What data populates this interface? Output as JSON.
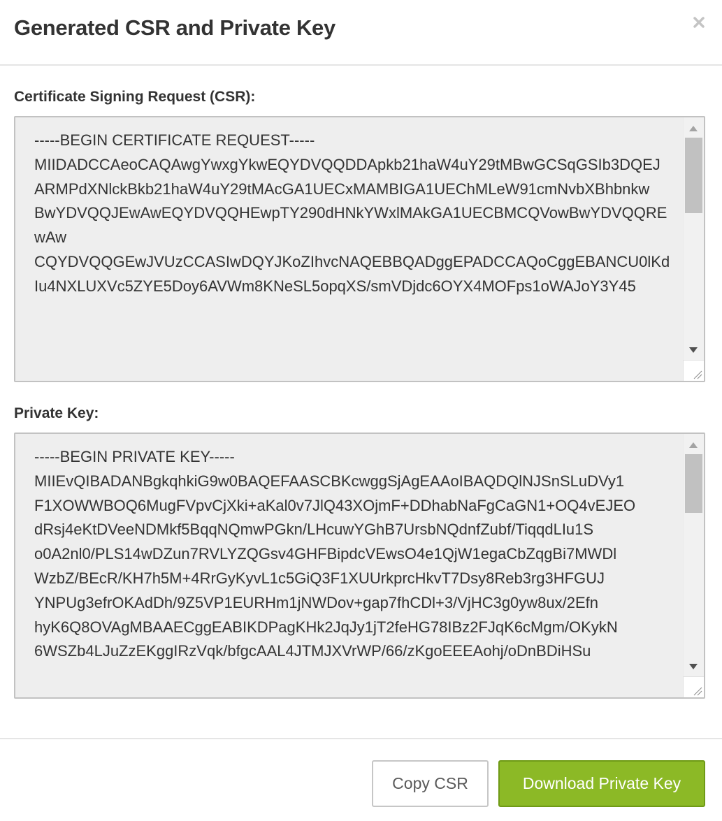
{
  "modal": {
    "title": "Generated CSR and Private Key",
    "close_icon": "close-icon"
  },
  "csr": {
    "label": "Certificate Signing Request (CSR):",
    "value": "-----BEGIN CERTIFICATE REQUEST-----\nMIIDADCCAeoCAQAwgYwxgYkwEQYDVQQDDApkb21haW4uY29tMBwGCSqGSIb3DQEJ\nARMPdXNlckBkb21haW4uY29tMAcGA1UECxMAMBIGA1UEChMLeW91cmNvbXBhbnkw\nBwYDVQQJEwAwEQYDVQQHEwpTY290dHNkYWxlMAkGA1UECBMCQVowBwYDVQQREwAw\nCQYDVQQGEwJVUzCCASIwDQYJKoZIhvcNAQEBBQADggEPADCCAQoCggEBANCU0lKd\nIu4NXLUXVc5ZYE5Doy6AVWm8KNeSL5opqXS/smVDjdc6OYX4MOFps1oWAJoY3Y45"
  },
  "private_key": {
    "label": "Private Key:",
    "value": "-----BEGIN PRIVATE KEY-----\nMIIEvQIBADANBgkqhkiG9w0BAQEFAASCBKcwggSjAgEAAoIBAQDQlNJSnSLuDVy1\nF1XOWWBOQ6MugFVpvCjXki+aKal0v7JlQ43XOjmF+DDhabNaFgCaGN1+OQ4vEJEO\ndRsj4eKtDVeeNDMkf5BqqNQmwPGkn/LHcuwYGhB7UrsbNQdnfZubf/TiqqdLIu1S\no0A2nl0/PLS14wDZun7RVLYZQGsv4GHFBipdcVEwsO4e1QjW1egaCbZqgBi7MWDl\nWzbZ/BEcR/KH7h5M+4RrGyKyvL1c5GiQ3F1XUUrkprcHkvT7Dsy8Reb3rg3HFGUJ\nYNPUg3efrOKAdDh/9Z5VP1EURHm1jNWDov+gap7fhCDl+3/VjHC3g0yw8ux/2Efn\nhyK6Q8OVAgMBAAECggEABIKDPagKHk2JqJy1jT2feHG78IBz2FJqK6cMgm/OKykN\n6WSZb4LJuZzEKggIRzVqk/bfgcAAL4JTMJXVrWP/66/zKgoEEEAohj/oDnBDiHSu"
  },
  "footer": {
    "copy_label": "Copy CSR",
    "download_label": "Download Private Key"
  },
  "colors": {
    "primary_button": "#8cb926",
    "textarea_bg": "#eeeeee"
  }
}
